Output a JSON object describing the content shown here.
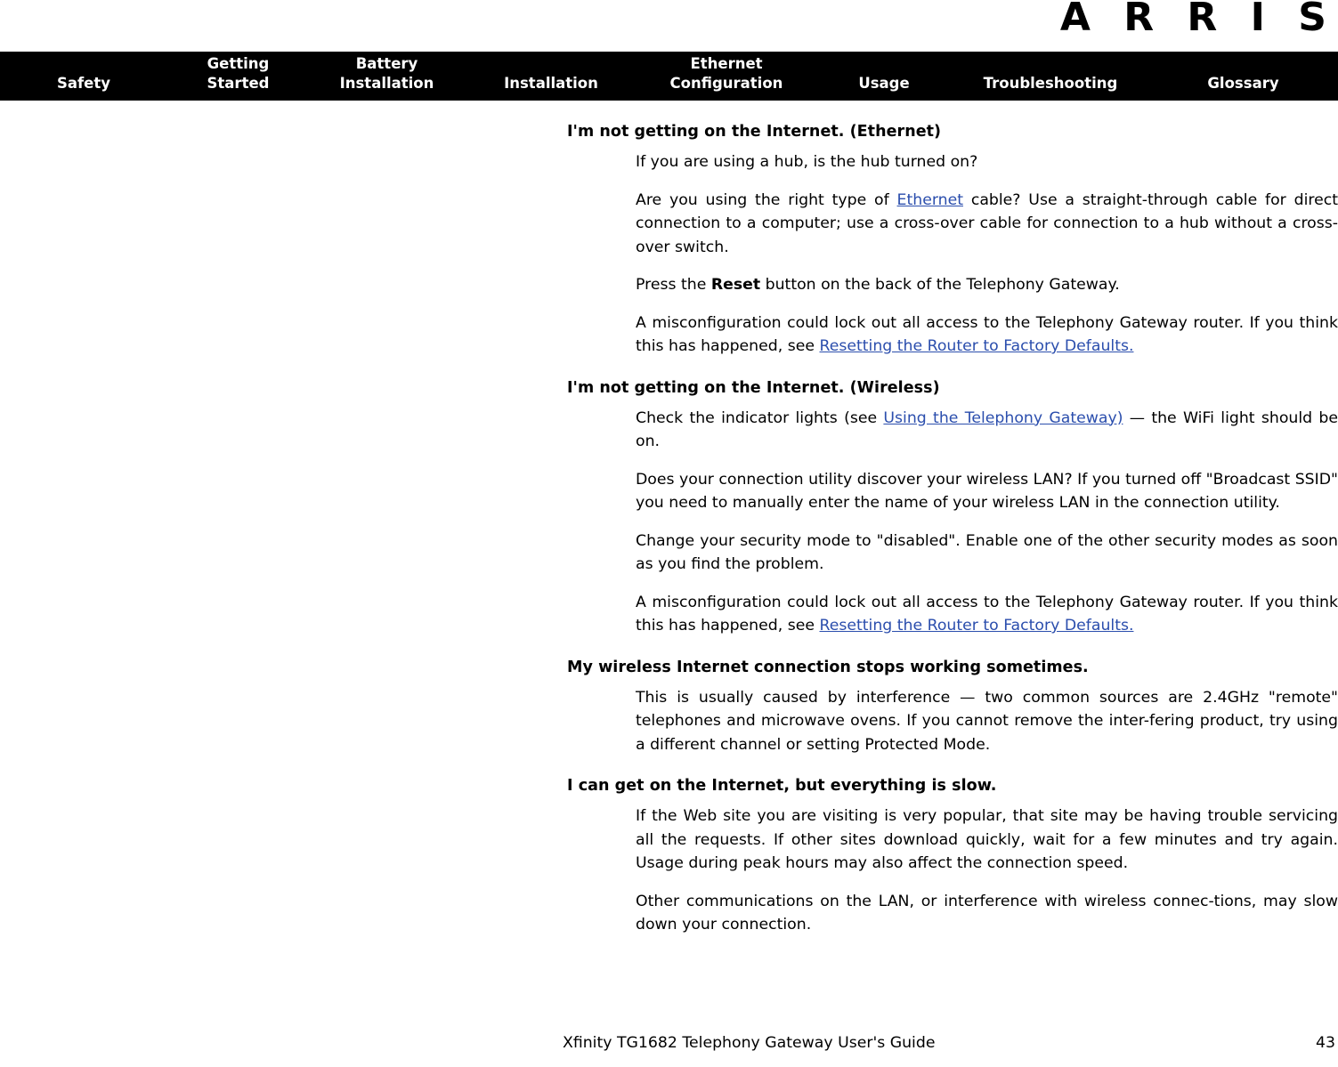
{
  "brand": {
    "logo_text": "A R R I S"
  },
  "nav": {
    "items": [
      {
        "label": "Safety"
      },
      {
        "label": "Getting\nStarted"
      },
      {
        "label": "Battery\nInstallation"
      },
      {
        "label": "Installation"
      },
      {
        "label": "Ethernet\nConfiguration"
      },
      {
        "label": "Usage"
      },
      {
        "label": "Troubleshooting"
      },
      {
        "label": "Glossary"
      }
    ]
  },
  "colors": {
    "nav_background": "#000000",
    "nav_text": "#ffffff",
    "link": "#2b4ead",
    "body_text": "#000000",
    "page_background": "#ffffff"
  },
  "sections": [
    {
      "heading": "I'm not getting on the Internet. (Ethernet)",
      "paragraphs": [
        {
          "parts": [
            {
              "type": "text",
              "text": "If you are using a hub, is the hub turned on?"
            }
          ]
        },
        {
          "parts": [
            {
              "type": "text",
              "text": "Are you using the right type of "
            },
            {
              "type": "link",
              "text": "Ethernet"
            },
            {
              "type": "text",
              "text": " cable? Use a straight-through cable for direct connection to a computer; use a cross-over cable for connection to a hub without a cross-over switch."
            }
          ]
        },
        {
          "parts": [
            {
              "type": "text",
              "text": "Press the "
            },
            {
              "type": "bold",
              "text": "Reset"
            },
            {
              "type": "text",
              "text": " button on the back of the Telephony Gateway."
            }
          ]
        },
        {
          "parts": [
            {
              "type": "text",
              "text": "A misconfiguration could lock out all access to the Telephony Gateway router. If you think this has happened, see "
            },
            {
              "type": "link",
              "text": "Resetting the Router to Factory Defaults."
            }
          ]
        }
      ]
    },
    {
      "heading": "I'm not getting on the Internet. (Wireless)",
      "paragraphs": [
        {
          "parts": [
            {
              "type": "text",
              "text": "Check the indicator lights (see "
            },
            {
              "type": "link",
              "text": "Using the Telephony Gateway)"
            },
            {
              "type": "text",
              "text": " — the WiFi light should be on."
            }
          ]
        },
        {
          "parts": [
            {
              "type": "text",
              "text": "Does your connection utility discover your wireless LAN? If you turned off \"Broadcast SSID\" you need to manually enter the name of your wireless LAN in the connection utility."
            }
          ]
        },
        {
          "parts": [
            {
              "type": "text",
              "text": "Change your security mode to \"disabled\". Enable one of the other security modes as soon as you find the problem."
            }
          ]
        },
        {
          "parts": [
            {
              "type": "text",
              "text": "A misconfiguration could lock out all access to the Telephony Gateway router. If you think this has happened, see "
            },
            {
              "type": "link",
              "text": "Resetting the Router to Factory Defaults."
            }
          ]
        }
      ]
    },
    {
      "heading": "My wireless Internet connection stops working sometimes.",
      "paragraphs": [
        {
          "parts": [
            {
              "type": "text",
              "text": "This is usually caused by interference — two common sources are 2.4GHz \"remote\" telephones and microwave ovens. If you cannot remove the inter-fering product, try using a different channel or setting Protected Mode."
            }
          ]
        }
      ]
    },
    {
      "heading": "I can get on the Internet, but everything is slow.",
      "paragraphs": [
        {
          "parts": [
            {
              "type": "text",
              "text": "If the Web site you are visiting is very popular, that site may be having trouble servicing all the requests. If other sites download quickly, wait for a few minutes and try again. Usage during peak hours may also affect the connection speed."
            }
          ]
        },
        {
          "parts": [
            {
              "type": "text",
              "text": "Other communications on the LAN, or interference with wireless connec-tions, may slow down your connection."
            }
          ]
        }
      ]
    }
  ],
  "footer": {
    "guide_title": "Xfinity TG1682 Telephony Gateway User's Guide",
    "page_number": "43"
  }
}
